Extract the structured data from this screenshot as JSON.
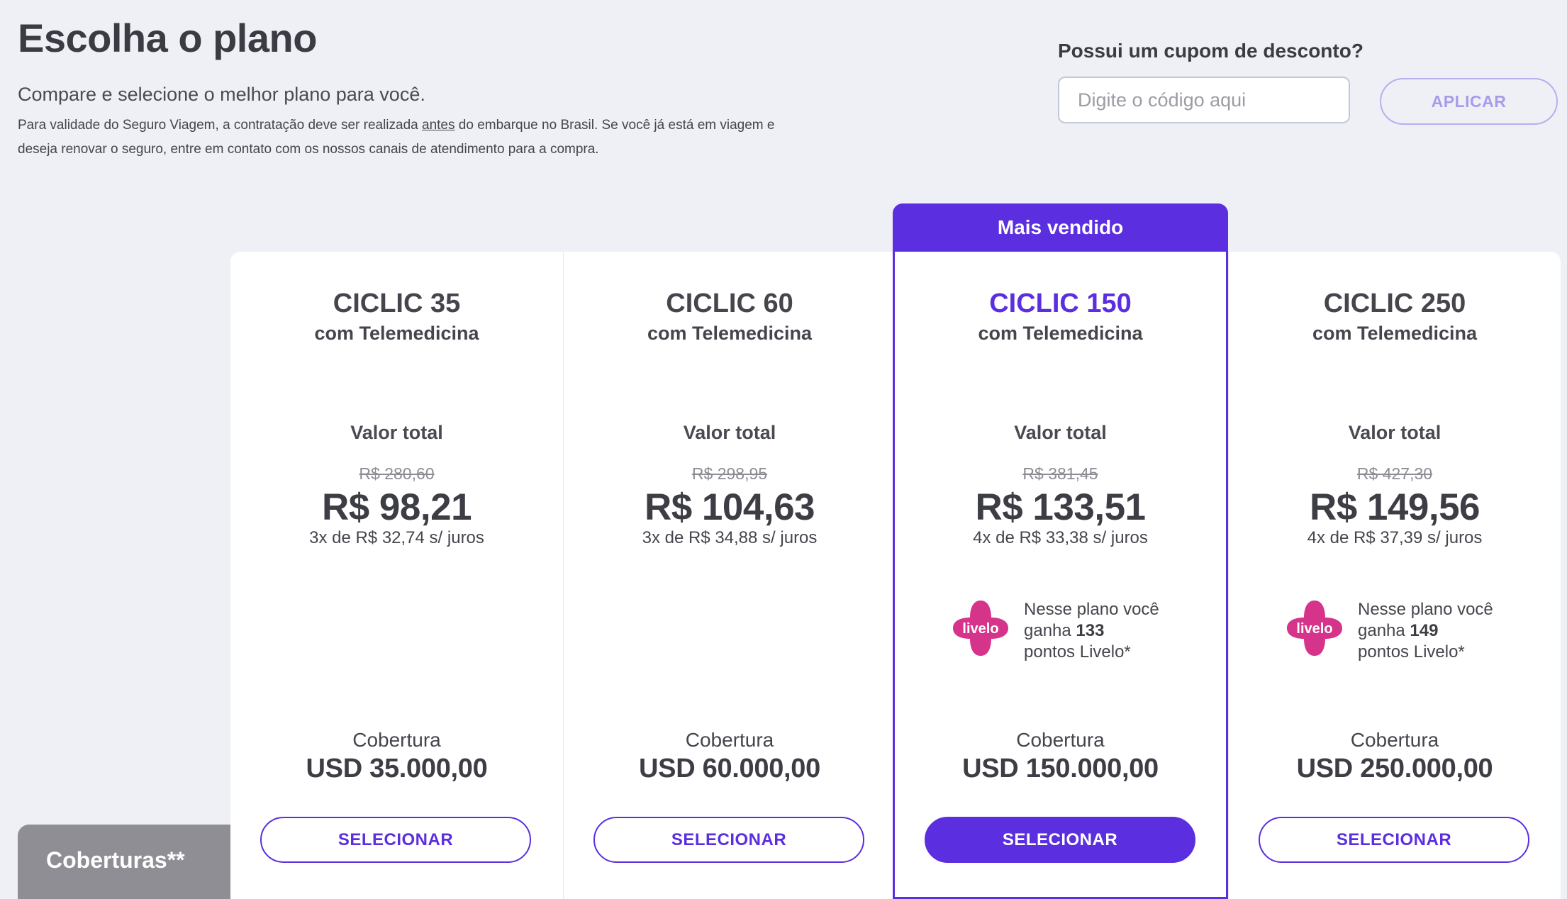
{
  "header": {
    "title": "Escolha o plano",
    "subtitle": "Compare e selecione o melhor plano para você.",
    "notice_part1": "Para validade do Seguro Viagem, a contratação deve ser realizada ",
    "notice_underlined": "antes",
    "notice_part2": " do embarque no Brasil. Se você já está em viagem e deseja renovar o seguro, entre em contato com os nossos canais de atendimento para a compra."
  },
  "coupon": {
    "label": "Possui um cupom de desconto?",
    "placeholder": "Digite o código aqui",
    "value": "",
    "apply_label": "APLICAR"
  },
  "badge": {
    "label": "Mais vendido"
  },
  "plans": [
    {
      "name": "CICLIC 35",
      "subtitle": "com Telemedicina",
      "value_label": "Valor total",
      "old_price": "R$ 280,60",
      "price": "R$ 98,21",
      "installments": "3x de R$ 32,74 s/ juros",
      "coverage_label": "Cobertura",
      "coverage_value": "USD 35.000,00",
      "select_label": "SELECIONAR"
    },
    {
      "name": "CICLIC 60",
      "subtitle": "com Telemedicina",
      "value_label": "Valor total",
      "old_price": "R$ 298,95",
      "price": "R$ 104,63",
      "installments": "3x de R$ 34,88 s/ juros",
      "coverage_label": "Cobertura",
      "coverage_value": "USD 60.000,00",
      "select_label": "SELECIONAR"
    },
    {
      "name": "CICLIC 150",
      "subtitle": "com Telemedicina",
      "value_label": "Valor total",
      "old_price": "R$ 381,45",
      "price": "R$ 133,51",
      "installments": "4x de R$ 33,38 s/ juros",
      "livelo": {
        "logo_text": "livelo",
        "line1": "Nesse plano você",
        "line2_prefix": "ganha ",
        "points": "133",
        "line3": "pontos Livelo*"
      },
      "coverage_label": "Cobertura",
      "coverage_value": "USD 150.000,00",
      "select_label": "SELECIONAR"
    },
    {
      "name": "CICLIC 250",
      "subtitle": "com Telemedicina",
      "value_label": "Valor total",
      "old_price": "R$ 427,30",
      "price": "R$ 149,56",
      "installments": "4x de R$ 37,39 s/ juros",
      "livelo": {
        "logo_text": "livelo",
        "line1": "Nesse plano você",
        "line2_prefix": "ganha ",
        "points": "149",
        "line3": "pontos Livelo*"
      },
      "coverage_label": "Cobertura",
      "coverage_value": "USD 250.000,00",
      "select_label": "SELECIONAR"
    }
  ],
  "coberturas": {
    "label": "Coberturas**"
  },
  "colors": {
    "accent": "#5b2ee0",
    "livelo": "#d6338a",
    "muted_button": "#a89bec",
    "background": "#eef0f5"
  },
  "icons": {
    "livelo_logo": "livelo-logo-icon"
  }
}
